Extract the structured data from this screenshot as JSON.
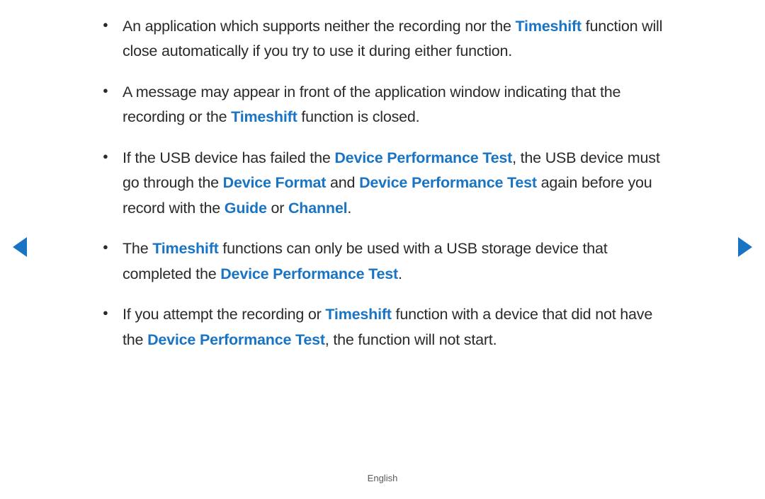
{
  "footer": {
    "language": "English"
  },
  "bullets": [
    {
      "segments": [
        {
          "t": "An application which supports neither the recording nor the ",
          "hl": false
        },
        {
          "t": "Timeshift",
          "hl": true
        },
        {
          "t": " function will close automatically if you try to use it during either function.",
          "hl": false
        }
      ]
    },
    {
      "segments": [
        {
          "t": "A message may appear in front of the application window indicating that the recording or the ",
          "hl": false
        },
        {
          "t": "Timeshift",
          "hl": true
        },
        {
          "t": " function is closed.",
          "hl": false
        }
      ]
    },
    {
      "segments": [
        {
          "t": "If the USB device has failed the ",
          "hl": false
        },
        {
          "t": "Device Performance Test",
          "hl": true
        },
        {
          "t": ", the USB device must go through the ",
          "hl": false
        },
        {
          "t": "Device Format",
          "hl": true
        },
        {
          "t": " and ",
          "hl": false
        },
        {
          "t": "Device Performance Test",
          "hl": true
        },
        {
          "t": " again before you record with the ",
          "hl": false
        },
        {
          "t": "Guide",
          "hl": true
        },
        {
          "t": " or ",
          "hl": false
        },
        {
          "t": "Channel",
          "hl": true
        },
        {
          "t": ".",
          "hl": false
        }
      ]
    },
    {
      "segments": [
        {
          "t": "The ",
          "hl": false
        },
        {
          "t": "Timeshift",
          "hl": true
        },
        {
          "t": " functions can only be used with a USB storage device that completed the ",
          "hl": false
        },
        {
          "t": "Device Performance Test",
          "hl": true
        },
        {
          "t": ".",
          "hl": false
        }
      ]
    },
    {
      "segments": [
        {
          "t": "If you attempt the recording or ",
          "hl": false
        },
        {
          "t": "Timeshift",
          "hl": true
        },
        {
          "t": " function with a device that did not have the ",
          "hl": false
        },
        {
          "t": "Device Performance Test",
          "hl": true
        },
        {
          "t": ", the function will not start.",
          "hl": false
        }
      ]
    }
  ]
}
